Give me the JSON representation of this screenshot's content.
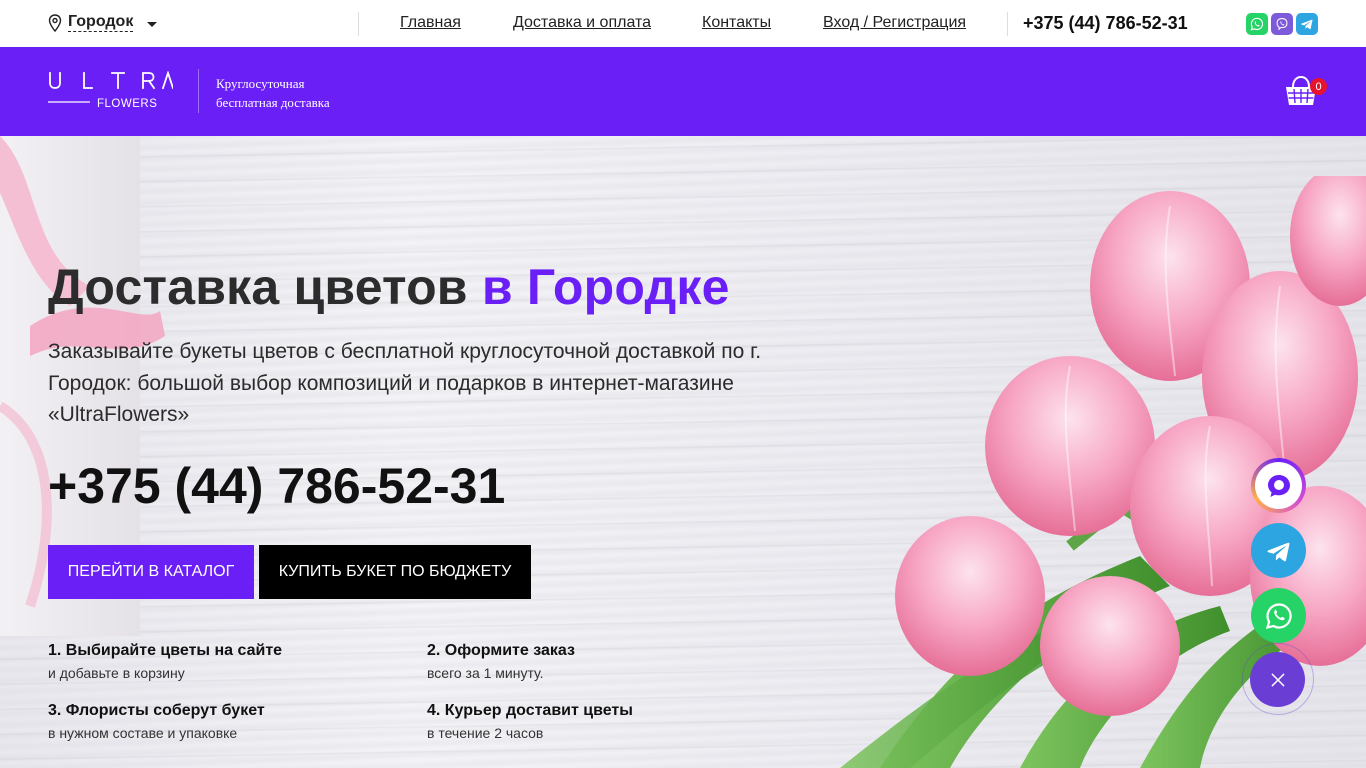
{
  "topbar": {
    "city": "Городок",
    "nav": [
      {
        "label": "Главная"
      },
      {
        "label": "Доставка и оплата"
      },
      {
        "label": "Контакты"
      },
      {
        "label": "Вход / Регистрация"
      }
    ],
    "phone": "+375 (44) 786-52-31",
    "messengers": [
      {
        "icon": "whatsapp-icon",
        "color": "#25d366"
      },
      {
        "icon": "viber-icon",
        "color": "#7d5ad9"
      },
      {
        "icon": "telegram-icon",
        "color": "#2ca5e0"
      }
    ]
  },
  "header": {
    "logo": {
      "word_top": "ULTRA",
      "word_bottom": "FLOWERS"
    },
    "tagline_line1": "Круглосуточная",
    "tagline_line2": "бесплатная доставка",
    "cart_count": "0",
    "accent_color": "#6a1ff7"
  },
  "hero": {
    "title_main": "Доставка цветов",
    "title_accent": "в Городке",
    "lead": "Заказывайте букеты цветов с бесплатной круглосуточной доставкой по г. Городок: большой выбор композиций и подарков в интернет-магазине «UltraFlowers»",
    "phone": "+375 (44) 786-52-31",
    "btn_catalog": "Перейти в каталог",
    "btn_budget": "Купить букет по бюджету",
    "steps": [
      {
        "title": "1. Выбирайте цветы на сайте",
        "desc": "и добавьте в корзину"
      },
      {
        "title": "2. Оформите заказ",
        "desc": "всего за 1 минуту."
      },
      {
        "title": "3. Флористы соберут букет",
        "desc": "в нужном составе и упаковке"
      },
      {
        "title": "4. Курьер доставит цветы",
        "desc": "в течение 2 часов"
      }
    ]
  },
  "floating_widgets": [
    {
      "icon": "chat-bubble-icon"
    },
    {
      "icon": "telegram-icon",
      "color": "#2ca5e0"
    },
    {
      "icon": "whatsapp-icon",
      "color": "#25d366"
    },
    {
      "icon": "close-icon",
      "color": "#6a3ed4"
    }
  ]
}
